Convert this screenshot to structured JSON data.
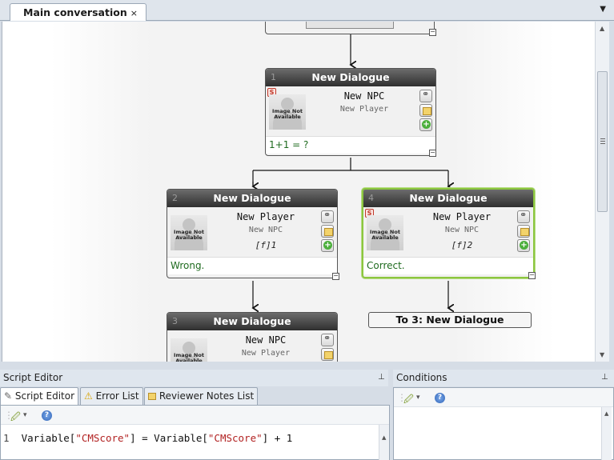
{
  "document_tab": {
    "label": "Main conversation",
    "close": "×",
    "dropdown": "▼"
  },
  "canvas": {
    "nodes": [
      {
        "id": "node-1",
        "number": "1",
        "title": "New Dialogue",
        "speaker": "New NPC",
        "listener": "New Player",
        "condition": "",
        "text": "1+1 = ?",
        "has_script": true,
        "image_label": "Image Not Available"
      },
      {
        "id": "node-2",
        "number": "2",
        "title": "New Dialogue",
        "speaker": "New Player",
        "listener": "New NPC",
        "condition": "[f]1",
        "text": "Wrong.",
        "has_script": false,
        "image_label": "Image Not Available"
      },
      {
        "id": "node-4",
        "number": "4",
        "title": "New Dialogue",
        "speaker": "New Player",
        "listener": "New NPC",
        "condition": "[f]2",
        "text": "Correct.",
        "has_script": true,
        "image_label": "Image Not Available"
      },
      {
        "id": "node-3",
        "number": "3",
        "title": "New Dialogue",
        "speaker": "New NPC",
        "listener": "New Player",
        "condition": "",
        "text": "",
        "has_script": false,
        "image_label": "Image Not Available"
      }
    ],
    "goto_label": "To 3: New Dialogue",
    "script_badge": "S",
    "collapse_glyph": "−"
  },
  "script_panel": {
    "title": "Script Editor",
    "pin": "📌",
    "tabs": [
      "Script Editor",
      "Error List",
      "Reviewer Notes List"
    ],
    "code_line_number": "1",
    "code": {
      "p1": "Variable[",
      "s1": "\"CMScore\"",
      "p2": "] = Variable[",
      "s2": "\"CMScore\"",
      "p3": "] + 1"
    }
  },
  "conditions_panel": {
    "title": "Conditions",
    "pin": "📌"
  },
  "toolbar": {
    "wand_glyph": "🖉",
    "dropdown_glyph": "▾",
    "help_glyph": "?"
  },
  "colors": {
    "selected_border": "#8cc63f",
    "node_text": "#1f6b1f",
    "string_literal": "#b22222"
  }
}
